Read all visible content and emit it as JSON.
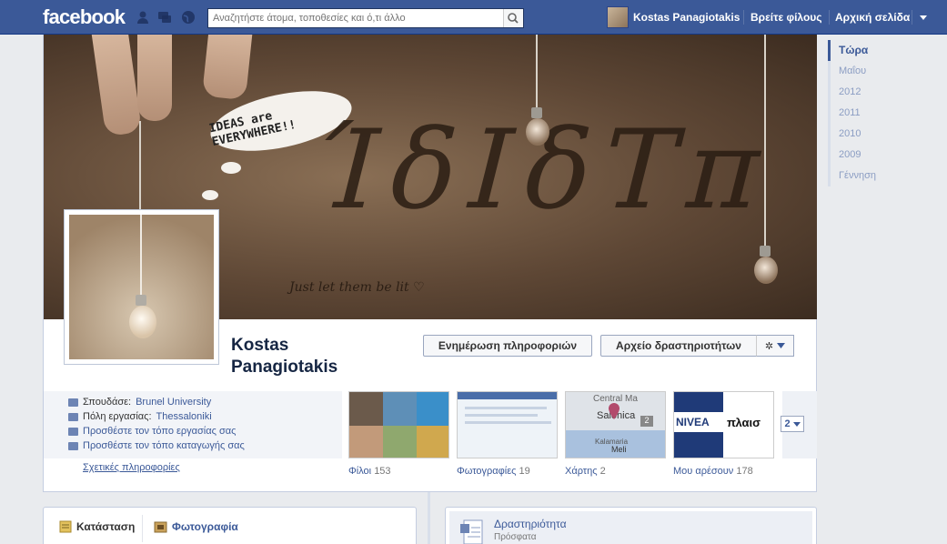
{
  "header": {
    "logo": "facebook",
    "search": {
      "placeholder": "Αναζητήστε άτομα, τοποθεσίες και ό,τι άλλο"
    },
    "user_name": "Kostas Panagiotakis",
    "find_friends": "Βρείτε φίλους",
    "home": "Αρχική σελίδα"
  },
  "cover": {
    "bubble_text": "IDEAS are EVERYWHERE!!",
    "caption": "Just let them be lit ♡"
  },
  "profile": {
    "name_line1": "Kostas",
    "name_line2": "Panagiotakis",
    "update_info": "Ενημέρωση πληροφοριών",
    "activity_log": "Αρχείο δραστηριοτήτων"
  },
  "info": {
    "studied_label": "Σπουδάσε:",
    "studied_value": "Brunel University",
    "city_label": "Πόλη εργασίας:",
    "city_value": "Thessaloniki",
    "add_work": "Προσθέστε τον τόπο εργασίας σας",
    "add_home": "Προσθέστε τον τόπο καταγωγής σας",
    "about": "Σχετικές πληροφορίες"
  },
  "thumbs": [
    {
      "label": "Φίλοι",
      "count": "153"
    },
    {
      "label": "Φωτογραφίες",
      "count": "19"
    },
    {
      "label": "Χάρτης",
      "count": "2"
    },
    {
      "label": "Μου αρέσουν",
      "count": "178"
    }
  ],
  "map_text": {
    "city": "Salonica",
    "area": "Kalamaria",
    "small": "Meli",
    "badge": "2",
    "top": "Central Ma"
  },
  "likes_text": {
    "a": "NIVEA",
    "b": "πλαισ"
  },
  "more_count": "2",
  "timeline": [
    "Τώρα",
    "Μαΐου",
    "2012",
    "2011",
    "2010",
    "2009",
    "Γέννηση"
  ],
  "composer": {
    "status": "Κατάσταση",
    "photo": "Φωτογραφία"
  },
  "activity": {
    "title": "Δραστηριότητα",
    "subtitle": "Πρόσφατα"
  },
  "colors": {
    "brand": "#3b5998",
    "background": "#e9ebee"
  }
}
